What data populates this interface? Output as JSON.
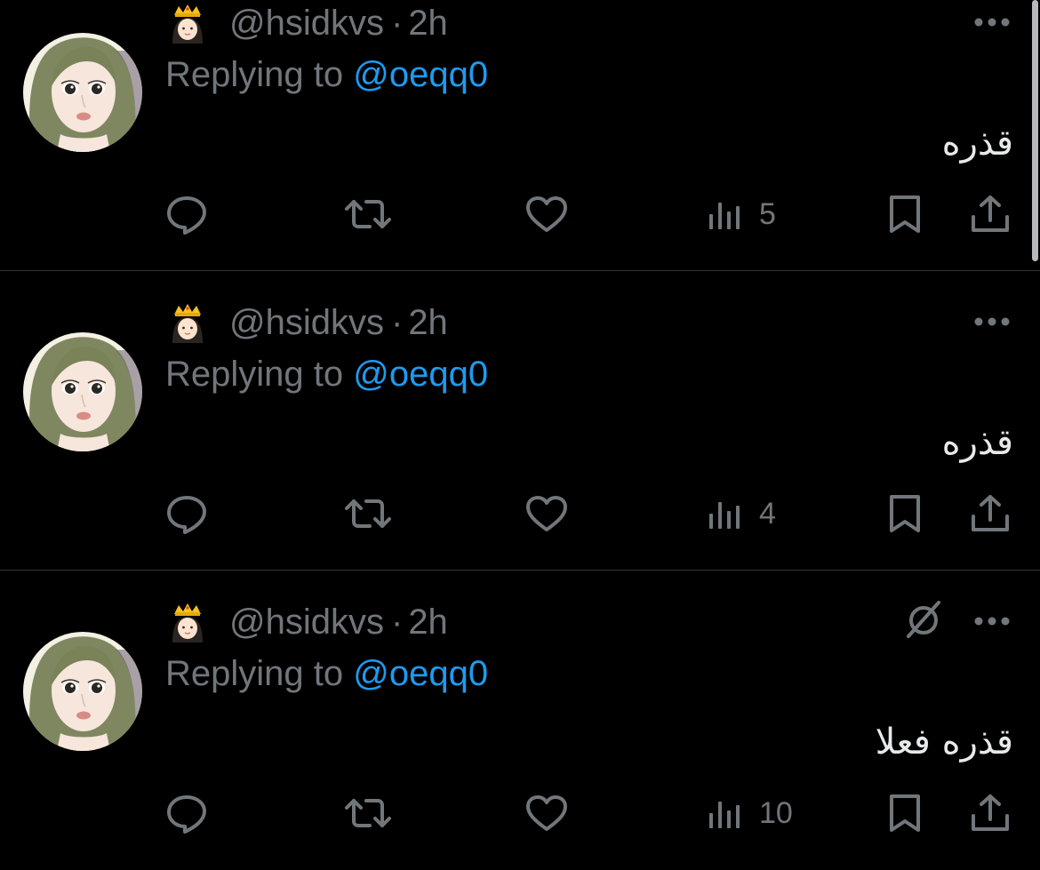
{
  "colors": {
    "background": "#000000",
    "text_primary": "#e7e9ea",
    "text_secondary": "#71767b",
    "accent": "#1d9bf0",
    "divider": "#2f3336"
  },
  "icons": {
    "reply": "speech-bubble-icon",
    "retweet": "retweet-icon",
    "like": "heart-icon",
    "views": "bar-chart-icon",
    "bookmark": "bookmark-icon",
    "share": "share-upload-icon",
    "more": "more-dots-icon",
    "translate": "translate-slash-icon",
    "name_emoji": "crowned-person-emoji"
  },
  "tweets": [
    {
      "handle": "@hsidkvs",
      "separator": "·",
      "time": "2h",
      "replying_prefix": "Replying to",
      "replying_to": "@oeqq0",
      "text": "قذره",
      "views": "5"
    },
    {
      "handle": "@hsidkvs",
      "separator": "·",
      "time": "2h",
      "replying_prefix": "Replying to",
      "replying_to": "@oeqq0",
      "text": "قذره",
      "views": "4"
    },
    {
      "handle": "@hsidkvs",
      "separator": "·",
      "time": "2h",
      "replying_prefix": "Replying to",
      "replying_to": "@oeqq0",
      "text": "قذره فعلا",
      "views": "10"
    }
  ]
}
